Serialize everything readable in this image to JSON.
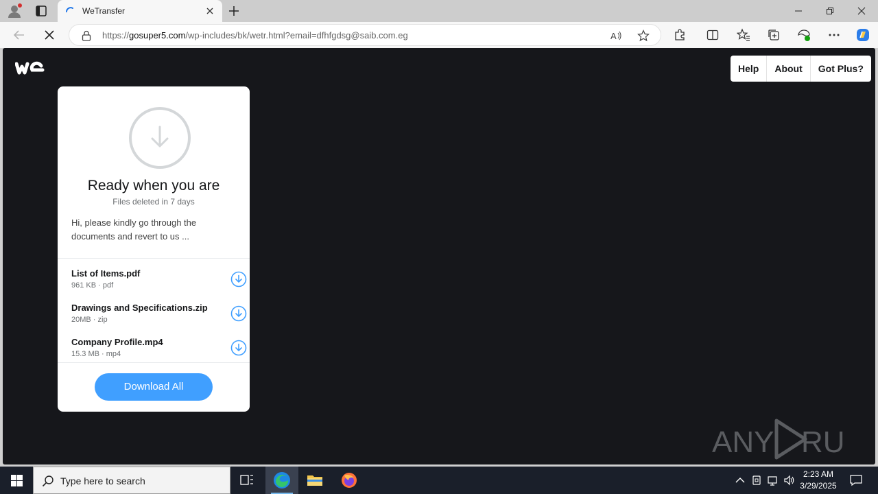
{
  "browser": {
    "tab": {
      "title": "WeTransfer"
    },
    "url": {
      "protocol": "https://",
      "host": "gosuper5.com",
      "path": "/wp-includes/bk/wetr.html?email=dfhfgdsg@saib.com.eg"
    }
  },
  "page": {
    "logo_icon": "wetransfer-we-logo",
    "nav": [
      "Help",
      "About",
      "Got Plus?"
    ],
    "card": {
      "icon": "download-circle-icon",
      "heading": "Ready when you are",
      "subheading": "Files deleted in 7 days",
      "message": "Hi, please kindly go through the documents and revert to us ...",
      "files": [
        {
          "name": "List of Items.pdf",
          "size": "961 KB",
          "type": "pdf"
        },
        {
          "name": "Drawings and Specifications.zip",
          "size": "20MB",
          "type": "zip"
        },
        {
          "name": "Company Profile.mp4",
          "size": "15.3 MB",
          "type": "mp4"
        }
      ],
      "download_all_label": "Download All"
    },
    "watermark": "ANY RUN",
    "colors": {
      "accent": "#409fff",
      "background": "#16171b"
    }
  },
  "taskbar": {
    "search_placeholder": "Type here to search",
    "time": "2:23 AM",
    "date": "3/29/2025"
  }
}
